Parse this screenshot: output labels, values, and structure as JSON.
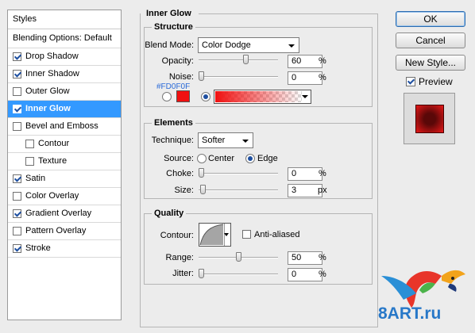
{
  "styles_panel": {
    "header": "Styles",
    "blending_options": "Blending Options: Default",
    "items": [
      {
        "label": "Drop Shadow",
        "checked": true
      },
      {
        "label": "Inner Shadow",
        "checked": true
      },
      {
        "label": "Outer Glow",
        "checked": false
      },
      {
        "label": "Inner Glow",
        "checked": true,
        "selected": true
      },
      {
        "label": "Bevel and Emboss",
        "checked": false
      },
      {
        "label": "Contour",
        "checked": false,
        "indent": true
      },
      {
        "label": "Texture",
        "checked": false,
        "indent": true
      },
      {
        "label": "Satin",
        "checked": true
      },
      {
        "label": "Color Overlay",
        "checked": false
      },
      {
        "label": "Gradient Overlay",
        "checked": true
      },
      {
        "label": "Pattern Overlay",
        "checked": false
      },
      {
        "label": "Stroke",
        "checked": true
      }
    ]
  },
  "title": "Inner Glow",
  "structure": {
    "label": "Structure",
    "blend_mode_label": "Blend Mode:",
    "blend_mode": "Color Dodge",
    "opacity_label": "Opacity:",
    "opacity": "60",
    "opacity_pct": 60,
    "noise_label": "Noise:",
    "noise": "0",
    "noise_pct": 0,
    "pct": "%",
    "color_hex": "#FD0F0F",
    "color": "#f01010"
  },
  "elements": {
    "label": "Elements",
    "technique_label": "Technique:",
    "technique": "Softer",
    "source_label": "Source:",
    "center": "Center",
    "edge": "Edge",
    "choke_label": "Choke:",
    "choke": "0",
    "choke_pct": 0,
    "size_label": "Size:",
    "size": "3",
    "size_frac": 0.02,
    "pct": "%",
    "px": "px"
  },
  "quality": {
    "label": "Quality",
    "contour_label": "Contour:",
    "anti_aliased": "Anti-aliased",
    "range_label": "Range:",
    "range": "50",
    "range_pct": 50,
    "jitter_label": "Jitter:",
    "jitter": "0",
    "jitter_pct": 0,
    "pct": "%"
  },
  "buttons": {
    "ok": "OK",
    "cancel": "Cancel",
    "new_style": "New Style...",
    "preview": "Preview"
  },
  "watermark": "8ART.ru"
}
